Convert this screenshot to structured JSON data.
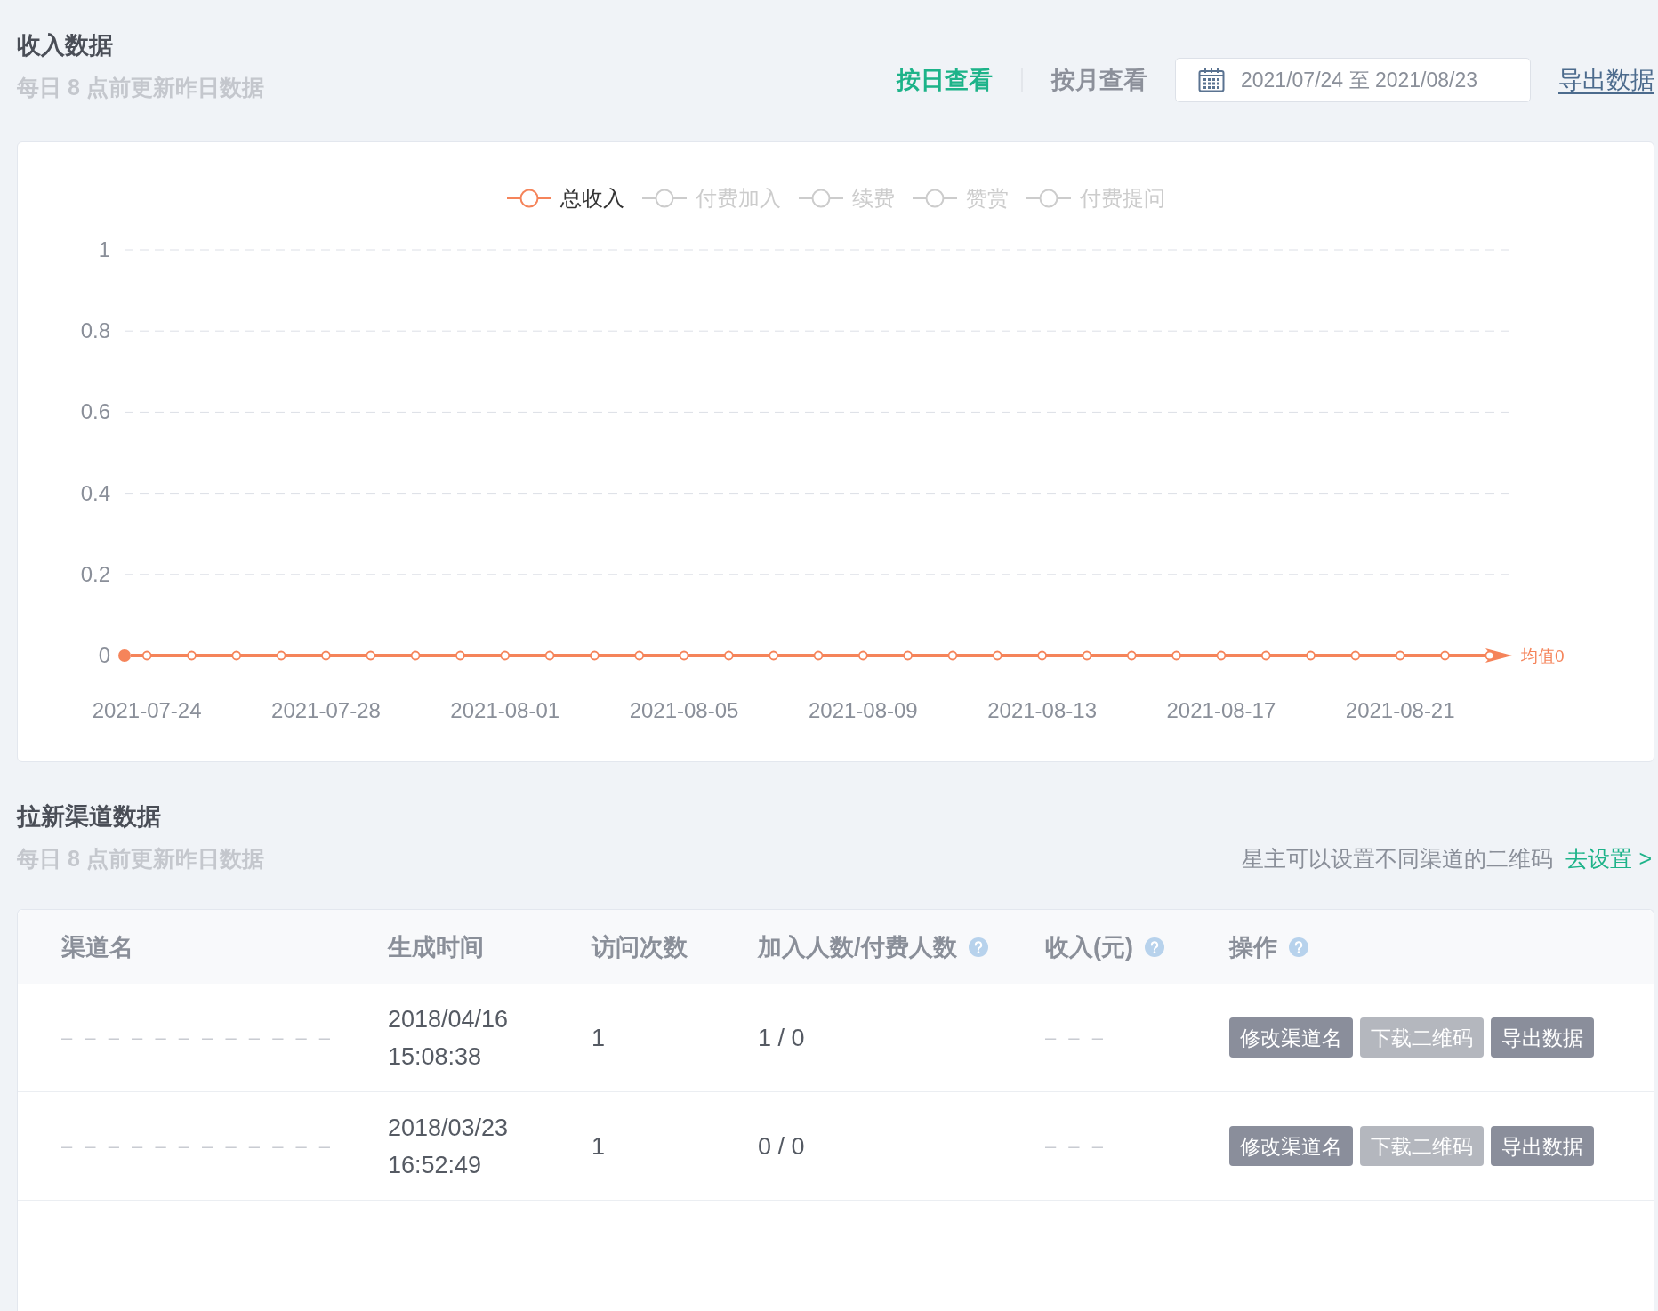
{
  "income_section": {
    "title": "收入数据",
    "subtitle": "每日 8 点前更新昨日数据",
    "view_tabs": [
      {
        "label": "按日查看",
        "selected": true
      },
      {
        "label": "按月查看",
        "selected": false
      }
    ],
    "date_range": {
      "value": "2021/07/24 至 2021/08/23"
    },
    "export_link": "导出数据",
    "legend": [
      {
        "selected": true
      },
      {
        "selected": false
      },
      {
        "selected": false
      },
      {
        "selected": false
      },
      {
        "selected": false
      }
    ],
    "chart_data": {
      "type": "line",
      "categories": [
        "2021-07-24",
        null,
        null,
        null,
        "2021-07-28",
        null,
        null,
        null,
        "2021-08-01",
        null,
        null,
        null,
        "2021-08-05",
        null,
        null,
        null,
        "2021-08-09",
        null,
        null,
        null,
        "2021-08-13",
        null,
        null,
        null,
        "2021-08-17",
        null,
        null,
        null,
        "2021-08-21",
        null,
        null
      ],
      "series": [
        {
          "name": "总收入",
          "color": "#f5845a",
          "marker": "circle",
          "values": [
            0,
            0,
            0,
            0,
            0,
            0,
            0,
            0,
            0,
            0,
            0,
            0,
            0,
            0,
            0,
            0,
            0,
            0,
            0,
            0,
            0,
            0,
            0,
            0,
            0,
            0,
            0,
            0,
            0,
            0,
            0
          ]
        },
        {
          "name": "付费加入",
          "values": [
            null,
            null,
            null,
            null,
            null,
            null,
            null,
            null,
            null,
            null,
            null,
            null,
            null,
            null,
            null,
            null,
            null,
            null,
            null,
            null,
            null,
            null,
            null,
            null,
            null,
            null,
            null,
            null,
            null,
            null,
            null
          ]
        },
        {
          "name": "续费",
          "values": [
            null,
            null,
            null,
            null,
            null,
            null,
            null,
            null,
            null,
            null,
            null,
            null,
            null,
            null,
            null,
            null,
            null,
            null,
            null,
            null,
            null,
            null,
            null,
            null,
            null,
            null,
            null,
            null,
            null,
            null,
            null
          ]
        },
        {
          "name": "赞赏",
          "values": [
            null,
            null,
            null,
            null,
            null,
            null,
            null,
            null,
            null,
            null,
            null,
            null,
            null,
            null,
            null,
            null,
            null,
            null,
            null,
            null,
            null,
            null,
            null,
            null,
            null,
            null,
            null,
            null,
            null,
            null,
            null
          ]
        },
        {
          "name": "付费提问",
          "values": [
            null,
            null,
            null,
            null,
            null,
            null,
            null,
            null,
            null,
            null,
            null,
            null,
            null,
            null,
            null,
            null,
            null,
            null,
            null,
            null,
            null,
            null,
            null,
            null,
            null,
            null,
            null,
            null,
            null,
            null,
            null
          ]
        }
      ],
      "ylim": [
        0,
        1
      ],
      "yticks": [
        0,
        0.2,
        0.4,
        0.6,
        0.8,
        1
      ],
      "grid": true,
      "ref_lines": [
        {
          "axis": "y",
          "value": 0,
          "label": "均值0"
        }
      ]
    }
  },
  "channel_section": {
    "title": "拉新渠道数据",
    "subtitle": "每日 8 点前更新昨日数据",
    "hint": "星主可以设置不同渠道的二维码",
    "settings_link": "去设置 >",
    "table": {
      "columns": [
        {
          "label": "渠道名",
          "help": false
        },
        {
          "label": "生成时间",
          "help": false
        },
        {
          "label": "访问次数",
          "help": false
        },
        {
          "label": "加入人数/付费人数",
          "help": true
        },
        {
          "label": "收入(元)",
          "help": true
        },
        {
          "label": "操作",
          "help": true
        }
      ],
      "rows": [
        {
          "name": "– – – – – – – – – – – –",
          "created": "2018/04/16 15:08:38",
          "visits": "1",
          "joined_paid": "1 / 0",
          "revenue": "– – –",
          "actions": [
            {
              "label": "修改渠道名",
              "disabled": false
            },
            {
              "label": "下载二维码",
              "disabled": true
            },
            {
              "label": "导出数据",
              "disabled": false
            }
          ]
        },
        {
          "name": "– – – – – – – – – – – –",
          "created": "2018/03/23 16:52:49",
          "visits": "1",
          "joined_paid": "0 / 0",
          "revenue": "– – –",
          "actions": [
            {
              "label": "修改渠道名",
              "disabled": false
            },
            {
              "label": "下载二维码",
              "disabled": true
            },
            {
              "label": "导出数据",
              "disabled": false
            }
          ]
        }
      ]
    }
  }
}
